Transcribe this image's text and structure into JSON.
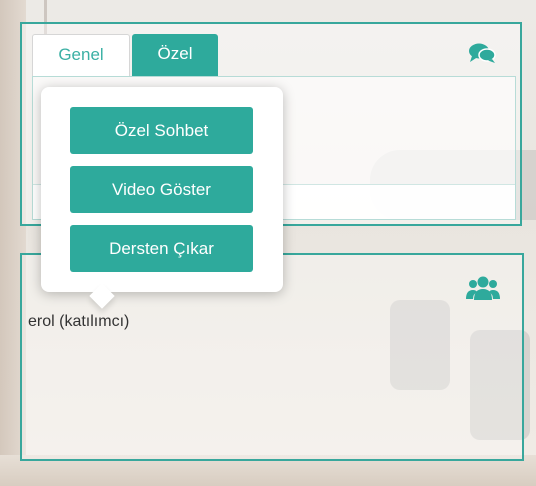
{
  "tabs": [
    {
      "label": "Genel",
      "active": false
    },
    {
      "label": "Özel",
      "active": true
    }
  ],
  "icons": {
    "chat": "chat-bubbles-icon",
    "users": "users-group-icon"
  },
  "popover": {
    "buttons": [
      {
        "label": "Özel Sohbet"
      },
      {
        "label": "Video Göster"
      },
      {
        "label": "Dersten Çıkar"
      }
    ]
  },
  "participants": [
    {
      "name": "erol (katılımcı)"
    }
  ],
  "colors": {
    "accent": "#2eaa9c",
    "border": "#38a79c"
  }
}
